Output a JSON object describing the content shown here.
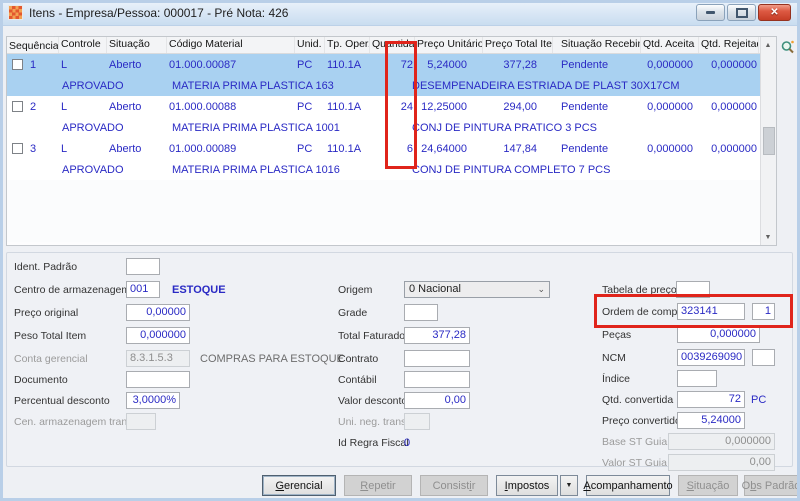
{
  "window": {
    "title": "Itens - Empresa/Pessoa: 000017 - Pré Nota: 426"
  },
  "icons": {
    "close": "✕",
    "scroll_up": "▲",
    "scroll_down": "▼",
    "dropdown_chevron": "⌄",
    "impostos_arrow": "▼"
  },
  "colors": {
    "selected_row": "#a9d1f1",
    "value_text": "#2a2ac4",
    "annotation": "#e0241b"
  },
  "grid": {
    "headers": [
      "Sequência",
      "Controle",
      "Situação",
      "Código Material",
      "Unid.",
      "Tp. Oper.",
      "Quantidade",
      "Preço Unitário",
      "Preço Total Item",
      "Situação Recebimen.",
      "Qtd. Aceita",
      "Qtd. Rejeitada"
    ],
    "rows": [
      {
        "seq": "1",
        "controle": "L",
        "situacao": "Aberto",
        "codigo": "01.000.00087",
        "unid": "PC",
        "tp_oper": "110.1A",
        "quantidade": "72",
        "preco_unitario": "5,24000",
        "preco_total_item": "377,28",
        "situacao_recebimento": "Pendente",
        "qtd_aceita": "0,000000",
        "qtd_rejeitada": "0,000000",
        "aprovacao": "APROVADO",
        "descricao_material": "MATERIA PRIMA PLASTICA 163",
        "descricao_item": "DESEMPENADEIRA ESTRIADA DE PLAST 30X17CM"
      },
      {
        "seq": "2",
        "controle": "L",
        "situacao": "Aberto",
        "codigo": "01.000.00088",
        "unid": "PC",
        "tp_oper": "110.1A",
        "quantidade": "24",
        "preco_unitario": "12,25000",
        "preco_total_item": "294,00",
        "situacao_recebimento": "Pendente",
        "qtd_aceita": "0,000000",
        "qtd_rejeitada": "0,000000",
        "aprovacao": "APROVADO",
        "descricao_material": "MATERIA PRIMA PLASTICA 1001",
        "descricao_item": "CONJ DE PINTURA PRATICO 3 PCS"
      },
      {
        "seq": "3",
        "controle": "L",
        "situacao": "Aberto",
        "codigo": "01.000.00089",
        "unid": "PC",
        "tp_oper": "110.1A",
        "quantidade": "6",
        "preco_unitario": "24,64000",
        "preco_total_item": "147,84",
        "situacao_recebimento": "Pendente",
        "qtd_aceita": "0,000000",
        "qtd_rejeitada": "0,000000",
        "aprovacao": "APROVADO",
        "descricao_material": "MATERIA PRIMA PLASTICA 1016",
        "descricao_item": "CONJ DE PINTURA COMPLETO 7 PCS"
      }
    ]
  },
  "form": {
    "left": [
      {
        "label": "Ident. Padrão",
        "value": ""
      },
      {
        "label": "Centro de armazenagem",
        "value": "001",
        "suffix": "ESTOQUE"
      },
      {
        "label": "Preço original",
        "value": "0,00000"
      },
      {
        "label": "Peso Total Item",
        "value": "0,000000"
      },
      {
        "label": "Conta gerencial",
        "value": "8.3.1.5.3",
        "suffix": "COMPRAS PARA ESTOQUE"
      },
      {
        "label": "Documento",
        "value": ""
      },
      {
        "label": "Percentual desconto",
        "value": "3,0000%"
      },
      {
        "label": "Cen. armazenagem transf",
        "value": ""
      }
    ],
    "middle": [
      {
        "label": "Origem",
        "value": "0 Nacional"
      },
      {
        "label": "Grade",
        "value": ""
      },
      {
        "label": "Total Faturado",
        "value": "377,28"
      },
      {
        "label": "Contrato",
        "value": ""
      },
      {
        "label": "Contábil",
        "value": ""
      },
      {
        "label": "Valor desconto",
        "value": "0,00"
      },
      {
        "label": "Uni. neg. transf.",
        "value": ""
      },
      {
        "label": "Id Regra Fiscal",
        "value": "0"
      }
    ],
    "right": [
      {
        "label": "Tabela de preço",
        "value": ""
      },
      {
        "label": "Ordem de compra",
        "value": "323141",
        "value2": "1"
      },
      {
        "label": "Peças",
        "value": "0,000000"
      },
      {
        "label": "NCM",
        "value": "0039269090",
        "value2": ""
      },
      {
        "label": "Índice",
        "value": ""
      },
      {
        "label": "Qtd. convertida",
        "value": "72",
        "suffix": "PC"
      },
      {
        "label": "Preço convertido",
        "value": "5,24000"
      },
      {
        "label": "Base ST Guia Avulsa",
        "value": "0,000000"
      },
      {
        "label": "Valor ST Guia Avulsa",
        "value": "0,00"
      }
    ]
  },
  "footer": {
    "buttons": [
      {
        "pre": "",
        "key": "G",
        "post": "erencial",
        "enabled": true
      },
      {
        "pre": "",
        "key": "R",
        "post": "epetir",
        "enabled": false
      },
      {
        "pre": "Consist",
        "key": "i",
        "post": "r",
        "enabled": false
      },
      {
        "pre": "",
        "key": "I",
        "post": "mpostos",
        "enabled": true
      },
      {
        "pre": "",
        "key": "A",
        "post": "companhamento",
        "enabled": true
      },
      {
        "pre": "",
        "key": "S",
        "post": "ituação",
        "enabled": false
      },
      {
        "pre": "O",
        "key": "b",
        "post": "s Padrão",
        "enabled": false
      }
    ]
  }
}
